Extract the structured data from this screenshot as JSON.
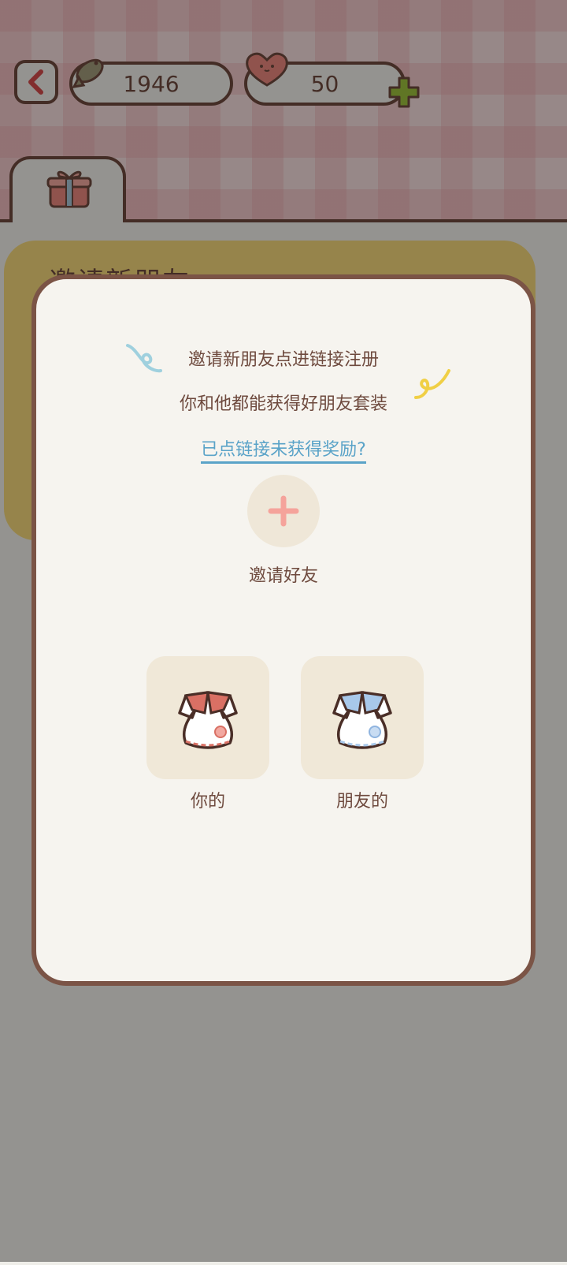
{
  "topbar": {
    "fish_count": "1946",
    "heart_count": "50"
  },
  "tabs": [
    {
      "icon": "gift-icon"
    }
  ],
  "background_card": {
    "title": "邀请新朋友"
  },
  "modal": {
    "line1": "邀请新朋友点进链接注册",
    "line2": "你和他都能获得好朋友套装",
    "link": "已点链接未获得奖励?",
    "invite_label": "邀请好友",
    "rewards": [
      {
        "label": "你的",
        "icon": "red-outfit-icon"
      },
      {
        "label": "朋友的",
        "icon": "blue-outfit-icon"
      }
    ]
  },
  "colors": {
    "brown": "#6e4a3e",
    "link": "#5aa3c8",
    "plus": "#f5a39b",
    "green": "#9bbf3c"
  }
}
